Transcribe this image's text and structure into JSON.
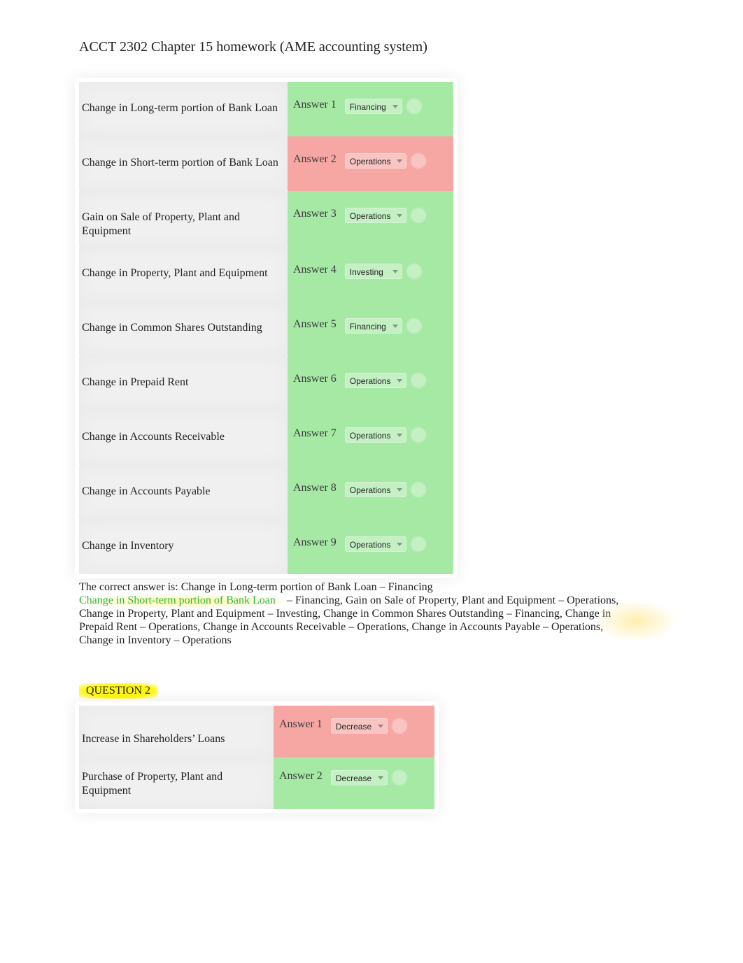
{
  "title": "ACCT 2302 Chapter 15 homework (AME accounting system)",
  "q1": {
    "rows": [
      {
        "question": "Change in Long-term portion of Bank Loan",
        "answer_label": "Answer 1",
        "value": "Financing",
        "status": "correct"
      },
      {
        "question": "Change in Short-term portion of Bank Loan",
        "answer_label": "Answer 2",
        "value": "Operations",
        "status": "incorrect"
      },
      {
        "question": "Gain on Sale of Property, Plant and Equipment",
        "answer_label": "Answer 3",
        "value": "Operations",
        "status": "correct"
      },
      {
        "question": "Change in Property, Plant and Equipment",
        "answer_label": "Answer 4",
        "value": "Investing",
        "status": "correct"
      },
      {
        "question": "Change in Common Shares Outstanding",
        "answer_label": "Answer 5",
        "value": "Financing",
        "status": "correct"
      },
      {
        "question": "Change in Prepaid Rent",
        "answer_label": "Answer 6",
        "value": "Operations",
        "status": "correct"
      },
      {
        "question": "Change in Accounts Receivable",
        "answer_label": "Answer 7",
        "value": "Operations",
        "status": "correct"
      },
      {
        "question": "Change in Accounts Payable",
        "answer_label": "Answer 8",
        "value": "Operations",
        "status": "correct"
      },
      {
        "question": "Change in Inventory",
        "answer_label": "Answer 9",
        "value": "Operations",
        "status": "correct"
      }
    ]
  },
  "answer_key": {
    "lead": "The correct answer is: Change in Long-term portion of Bank Loan – Financing",
    "highlight": "Change in Short-term portion of Bank Loan",
    "rest": " – Financing, Gain on Sale of Property, Plant and Equipment – Operations, Change in Property, Plant and Equipment – Investing, Change in Common Shares Outstanding – Financing, Change in Prepaid Rent – Operations, Change in Accounts Receivable – Operations, Change in Accounts Payable – Operations, Change in Inventory – Operations"
  },
  "q2": {
    "label": "QUESTION 2",
    "rows": [
      {
        "question": "Increase in Shareholders’ Loans",
        "answer_label": "Answer 1",
        "value": "Decrease",
        "status": "incorrect"
      },
      {
        "question": "Purchase of Property, Plant and Equipment",
        "answer_label": "Answer 2",
        "value": "Decrease",
        "status": "correct"
      }
    ]
  }
}
